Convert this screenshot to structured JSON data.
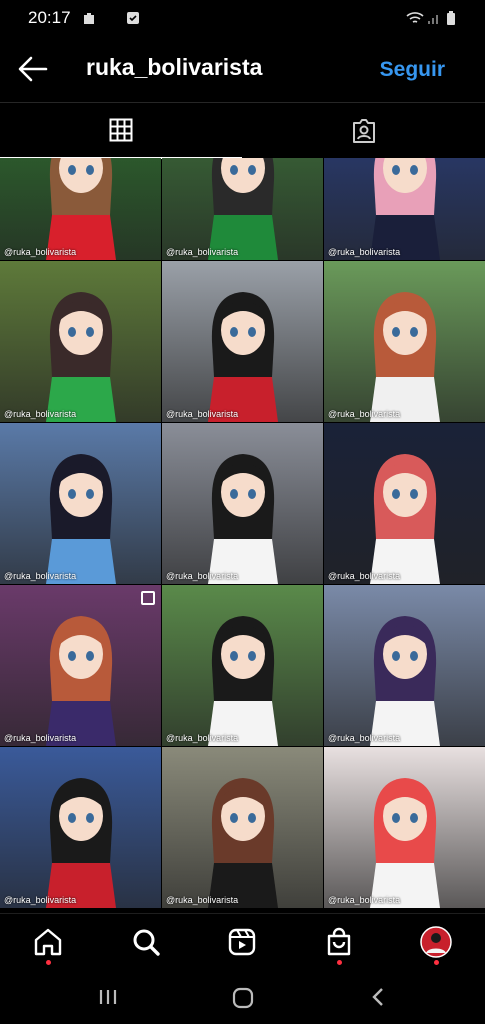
{
  "status_bar": {
    "time": "20:17"
  },
  "header": {
    "username": "ruka_bolivarista",
    "follow_label": "Seguir"
  },
  "tabs": [
    {
      "name": "grid-tab"
    },
    {
      "name": "tagged-tab"
    }
  ],
  "posts": [
    {
      "watermark": "@ruka_bolivarista",
      "bg": "#2f6b2f",
      "shirt": "#d8202c",
      "hair": "#8a5a3a"
    },
    {
      "watermark": "@ruka_bolivarista",
      "bg": "#3d6e3a",
      "shirt": "#1f8a3a",
      "hair": "#2a2a2a"
    },
    {
      "watermark": "@ruka_bolivarista",
      "bg": "#2a3e7a",
      "shirt": "#1a1f3a",
      "hair": "#e8a0b8"
    },
    {
      "watermark": "@ruka_bolivarista",
      "bg": "#5e7a3a",
      "shirt": "#2ca84a",
      "hair": "#3a2a2a"
    },
    {
      "watermark": "@ruka_bolivarista",
      "bg": "#9aa0a8",
      "shirt": "#c8202c",
      "hair": "#1a1a1a"
    },
    {
      "watermark": "@ruka_bolivarista",
      "bg": "#6a9a5a",
      "shirt": "#f0f0f0",
      "hair": "#b85a3a"
    },
    {
      "watermark": "@ruka_bolivarista",
      "bg": "#5a7aa8",
      "shirt": "#5a9ad8",
      "hair": "#1a1a2a"
    },
    {
      "watermark": "@ruka_bolivarista",
      "bg": "#8a8e98",
      "shirt": "#f4f4f4",
      "hair": "#1a1a1a"
    },
    {
      "watermark": "@ruka_bolivarista",
      "bg": "#1a2238",
      "shirt": "#f4f4f4",
      "hair": "#d85a5a"
    },
    {
      "watermark": "@ruka_bolivarista",
      "bg": "#6a3a6a",
      "shirt": "#3a2a6a",
      "hair": "#b85a3a"
    },
    {
      "watermark": "@ruka_bolivarista",
      "bg": "#5a8a4a",
      "shirt": "#f4f4f4",
      "hair": "#1a1a1a"
    },
    {
      "watermark": "@ruka_bolivarista",
      "bg": "#7a8aa8",
      "shirt": "#f4f4f4",
      "hair": "#3a2a5a"
    },
    {
      "watermark": "@ruka_bolivarista",
      "bg": "#3a5a9a",
      "shirt": "#c8202c",
      "hair": "#1a1a1a"
    },
    {
      "watermark": "@ruka_bolivarista",
      "bg": "#8a8a7a",
      "shirt": "#1a1a1a",
      "hair": "#6a3a2a"
    },
    {
      "watermark": "@ruka_bolivarista",
      "bg": "#e8e0e0",
      "shirt": "#f4f4f4",
      "hair": "#e84a4a"
    }
  ],
  "colors": {
    "accent": "#3797f0",
    "notification_dot": "#ff3040"
  }
}
